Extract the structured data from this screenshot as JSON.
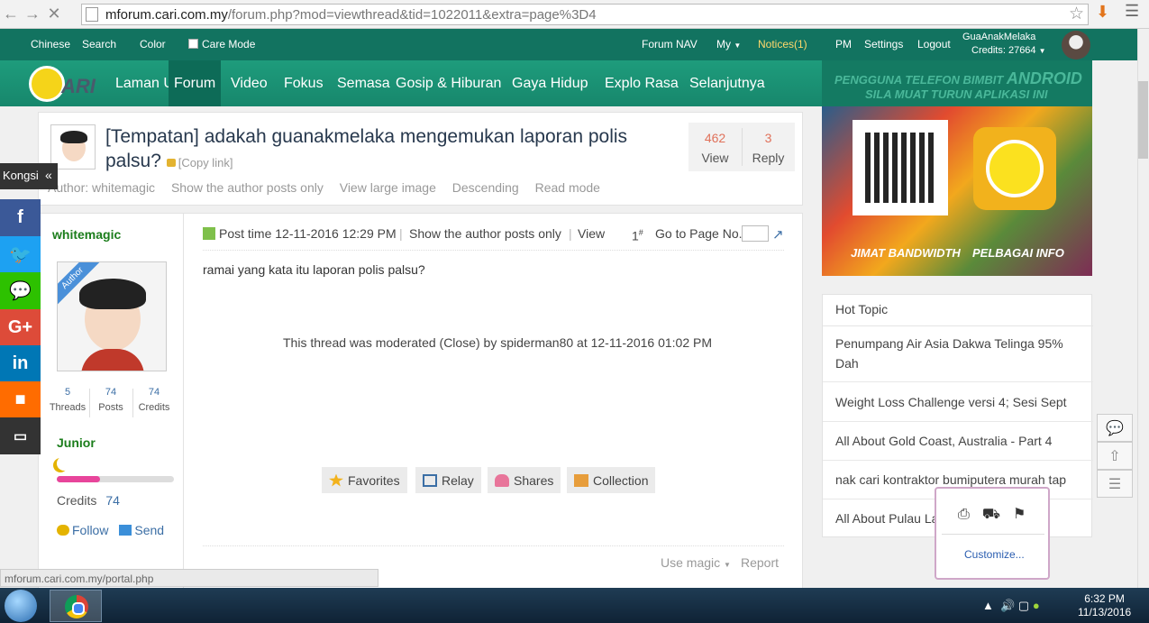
{
  "browser": {
    "url_host": "mforum.cari.com.my",
    "url_path": "/forum.php?mod=viewthread&tid=1022011&extra=page%3D4",
    "status_url": "mforum.cari.com.my/portal.php"
  },
  "topbar": {
    "chinese": "Chinese",
    "search": "Search",
    "color": "Color",
    "care_mode": "Care Mode",
    "forum_nav": "Forum NAV",
    "my": "My",
    "notices": "Notices(1)",
    "pm": "PM",
    "settings": "Settings",
    "logout": "Logout",
    "user_name": "GuaAnakMelaka",
    "user_credits": "Credits: 27664"
  },
  "mainnav": {
    "logo_text": "ARI",
    "items": [
      "Laman Utama",
      "Forum",
      "Video",
      "Fokus",
      "Semasa",
      "Gosip & Hiburan",
      "Gaya Hidup",
      "Explo Rasa",
      "Selanjutnya"
    ]
  },
  "ad": {
    "line1": "PENGGUNA TELEFON BIMBIT",
    "line1_big": "ANDROID",
    "line2": "SILA MUAT TURUN APLIKASI INI",
    "caption_left": "JIMAT BANDWIDTH",
    "caption_right": "PELBAGAI INFO"
  },
  "thread": {
    "title": "[Tempatan] adakah guanakmelaka mengemukan laporan polis palsu?",
    "copy_link": "[Copy link]",
    "views": "462",
    "views_label": "View",
    "replies": "3",
    "replies_label": "Reply",
    "links": [
      "Author: whitemagic",
      "Show the author posts only",
      "View large image",
      "Descending",
      "Read mode"
    ]
  },
  "post": {
    "author": "whitemagic",
    "author_badge": "Author",
    "threads": "5",
    "threads_label": "Threads",
    "posts": "74",
    "posts_label": "Posts",
    "credits": "74",
    "credits_label": "Credits",
    "rank": "Junior",
    "rank_progress": 0.37,
    "credits_row_label": "Credits",
    "credits_row_value": "74",
    "follow": "Follow",
    "send": "Send",
    "post_time": "Post time 12-11-2016 12:29 PM",
    "show_author": "Show the author posts only",
    "view": "View",
    "floor": "1",
    "floor_sup": "#",
    "goto_page": "Go to Page No.",
    "body": "ramai yang kata itu laporan polis palsu?",
    "moderated": "This thread was moderated (Close) by spiderman80 at 12-11-2016 01:02 PM",
    "actions": [
      "Favorites",
      "Relay",
      "Shares",
      "Collection"
    ],
    "use_magic": "Use magic",
    "report": "Report"
  },
  "hot_topic": {
    "title": "Hot Topic",
    "items": [
      "Penumpang Air Asia Dakwa Telinga 95% Dah",
      "Weight Loss Challenge versi 4; Sesi Sept",
      "All About Gold Coast, Australia - Part 4",
      "nak cari kontraktor bumiputera murah tap",
      "All About Pulau La"
    ]
  },
  "share": {
    "label": "Kongsi"
  },
  "tray_popup": {
    "customize": "Customize..."
  },
  "taskbar": {
    "time": "6:32 PM",
    "date": "11/13/2016"
  },
  "colors": {
    "topbar": "#127360",
    "mainnav": "#1e9c7c",
    "notices": "#ffd86b",
    "facebook": "#3b5998",
    "twitter": "#1da1f2",
    "wechat": "#2dc100",
    "googleplus": "#dd4b39",
    "linkedin": "#0077b5",
    "video": "#ff6c00",
    "comment": "#333333"
  },
  "icons": [
    "back-icon",
    "forward-icon",
    "close-load-icon",
    "star-icon",
    "download-icon",
    "menu-icon",
    "lock-icon",
    "pt-icon",
    "go-icon",
    "star-fav-icon",
    "relay-icon",
    "heart-icon",
    "collection-icon",
    "facebook-icon",
    "twitter-icon",
    "wechat-icon",
    "googleplus-icon",
    "linkedin-icon",
    "video-icon",
    "comment-icon",
    "reply-tool-icon",
    "top-tool-icon",
    "list-tool-icon"
  ]
}
